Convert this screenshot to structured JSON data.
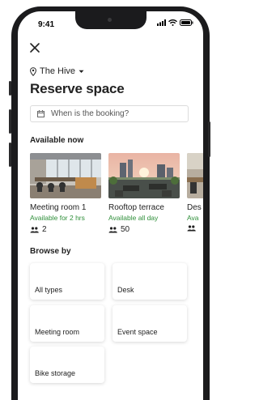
{
  "status_bar": {
    "time": "9:41"
  },
  "header": {
    "location": "The Hive",
    "title": "Reserve space"
  },
  "booking": {
    "placeholder": "When is the booking?"
  },
  "available_now": {
    "heading": "Available now",
    "cards": [
      {
        "name": "Meeting room 1",
        "availability": "Available for 2 hrs",
        "capacity": "2"
      },
      {
        "name": "Rooftop terrace",
        "availability": "Available all day",
        "capacity": "50"
      },
      {
        "name": "Des",
        "availability": "Ava",
        "capacity": ""
      }
    ]
  },
  "browse_by": {
    "heading": "Browse by",
    "tiles": [
      "All types",
      "Desk",
      "Meeting room",
      "Event space",
      "Bike storage"
    ]
  },
  "colors": {
    "accent_green": "#2f8f3a",
    "text": "#222222",
    "phone_frame": "#1b1b1d"
  }
}
